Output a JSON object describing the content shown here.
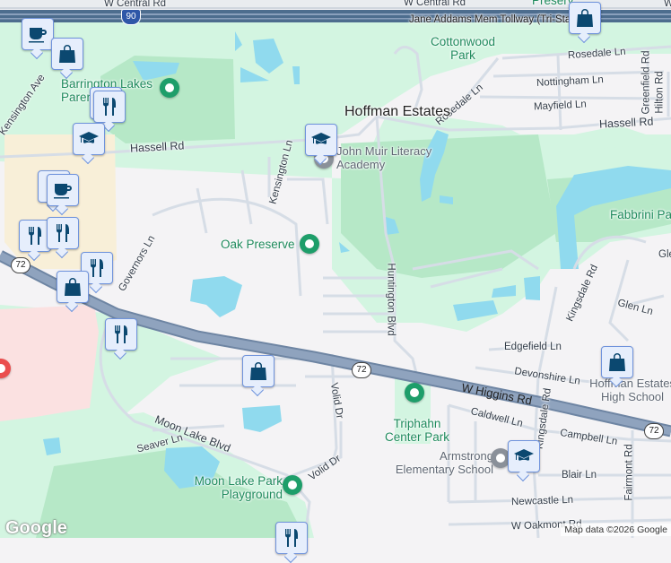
{
  "map": {
    "colors": {
      "background": "#f4f3f5",
      "green": "#d3f5e1",
      "park": "#b4e8c6",
      "water": "#90daee",
      "highway": "#8aa0bc",
      "tollway": "#4d6d8e",
      "commercial": "#f8efd8",
      "hospital": "#fbe1e1",
      "pin_icon": "#0b4870",
      "park_pin": "#1e9e6a"
    },
    "roads": {
      "w_central_rd_1": "W Central Rd",
      "w_central_rd_2": "W Central Rd",
      "w_partial": "W",
      "tollway": "Jane Addams Mem Tollway (Tri-State)",
      "rosedale_ln_1": "Rosedale Ln",
      "rosedale_ln_2": "Rosedale Ln",
      "nottingham_ln": "Nottingham Ln",
      "mayfield_ln": "Mayfield Ln",
      "greenfield_rd": "Greenfield Rd",
      "hilton_rd": "Hilton Rd",
      "hassell_rd_1": "Hassell Rd",
      "hassell_rd_2": "Hassell Rd",
      "kensington_ave": "Kensington Ave",
      "kensington_ln": "Kensington Ln",
      "governors_ln": "Governors Ln",
      "huntington_blvd": "Huntington Blvd",
      "kingsdale_rd": "Kingsdale Rd",
      "glen": "Glen",
      "glen_ln": "Glen Ln",
      "edgefield_ln": "Edgefield Ln",
      "devonshire_ln": "Devonshire Ln",
      "w_higgins_rd": "W Higgins Rd",
      "caldwell_ln": "Caldwell Ln",
      "campbell_ln": "Campbell Ln",
      "kingsdale_rd_2": "Kingsdale Rd",
      "fairmont_rd": "Fairmont Rd",
      "blair_ln": "Blair Ln",
      "newcastle_ln": "Newcastle Ln",
      "w_oakmont_rd": "W Oakmont Rd",
      "moon_lake_blvd": "Moon Lake Blvd",
      "seaver_ln": "Seaver Ln",
      "volid_dr_1": "Volid Dr",
      "volid_dr_2": "Volid Dr"
    },
    "shields": {
      "i90": "90",
      "r72_a": "72",
      "r72_b": "72",
      "r72_c": "72"
    },
    "places": {
      "city": "Hoffman Estates",
      "preserve": "Preserv",
      "cottonwood": "Cottonwood Park",
      "barrington": "Barrington Lakes Parents",
      "john_muir": "John Muir Literacy Academy",
      "oak_preserve": "Oak Preserve",
      "fabbrini": "Fabbrini Park",
      "hoffman_hs": "Hoffman Estates High School",
      "triphahn": "Triphahn Center Park",
      "armstrong": "Armstrong Elementary School",
      "moon_lake": "Moon Lake Park Playground"
    },
    "markers": [
      "coffee",
      "shopping",
      "restaurant",
      "school",
      "school",
      "coffee",
      "restaurant",
      "restaurant",
      "restaurant",
      "shopping",
      "restaurant",
      "shopping",
      "shopping",
      "shopping",
      "school",
      "restaurant"
    ],
    "logo": "Google",
    "attribution": "Map data ©2026 Google"
  }
}
